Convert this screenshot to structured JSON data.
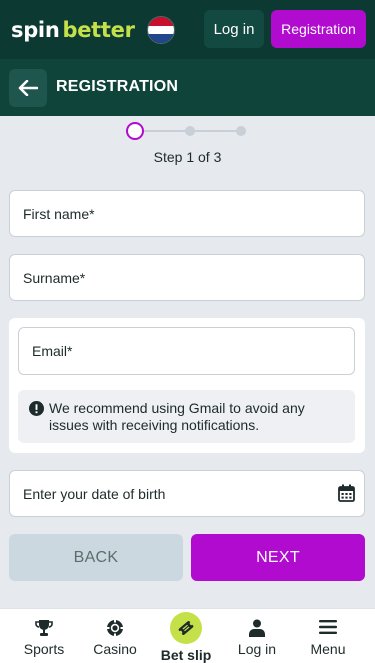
{
  "header": {
    "logo_part1": "spin",
    "logo_part2": "better",
    "flag": "netherlands-flag",
    "login_label": "Log in",
    "registration_label": "Registration"
  },
  "titlebar": {
    "title": "REGISTRATION",
    "back_icon": "arrow-left-icon"
  },
  "stepper": {
    "current": 1,
    "total": 3,
    "text": "Step 1 of 3"
  },
  "form": {
    "first_name_placeholder": "First name*",
    "surname_placeholder": "Surname*",
    "email_placeholder": "Email*",
    "email_notice": "We recommend using Gmail to avoid any issues with receiving notifications.",
    "dob_placeholder": "Enter your date of birth",
    "back_label": "BACK",
    "next_label": "NEXT"
  },
  "bottom_nav": {
    "items": [
      {
        "label": "Sports",
        "icon": "trophy-icon"
      },
      {
        "label": "Casino",
        "icon": "chip-icon"
      },
      {
        "label": "Bet slip",
        "icon": "ticket-icon"
      },
      {
        "label": "Log in",
        "icon": "user-icon"
      },
      {
        "label": "Menu",
        "icon": "menu-icon"
      }
    ]
  },
  "colors": {
    "header_bg": "#0c3a33",
    "accent_purple": "#b10bd0",
    "accent_lime": "#c5e14a",
    "page_bg": "#e6e9ee"
  }
}
